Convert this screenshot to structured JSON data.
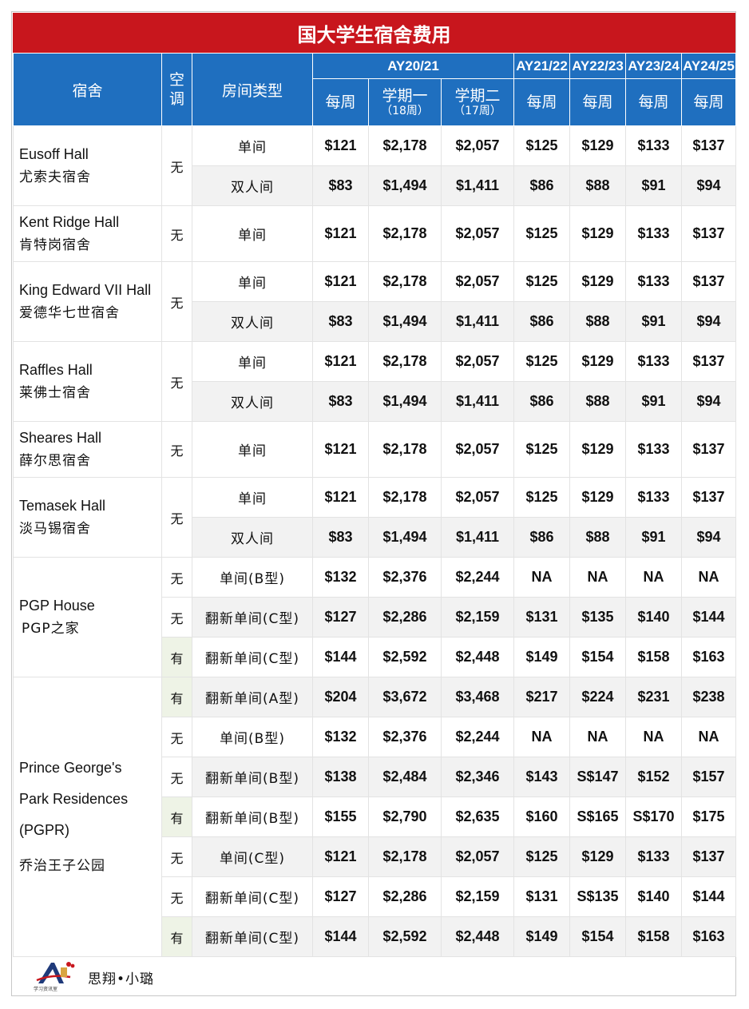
{
  "title": "国大学生宿舍费用",
  "headers": {
    "hall": "宿舍",
    "ac": "空调",
    "room_type": "房间类型",
    "ay2021": "AY20/21",
    "ay2122": "AY21/22",
    "ay2223": "AY22/23",
    "ay2324": "AY23/24",
    "ay2425": "AY24/25",
    "weekly": "每周",
    "sem1": "学期一",
    "sem1_weeks": "（18周）",
    "sem2": "学期二",
    "sem2_weeks": "（17周）"
  },
  "rows": [
    {
      "hall_en": "Eusoff Hall",
      "hall_cn": "尤索夫宿舍",
      "ac": "无",
      "room": "单间",
      "vals": [
        "$121",
        "$2,178",
        "$2,057",
        "$125",
        "$129",
        "$133",
        "$137"
      ]
    },
    {
      "ac": "",
      "room": "双人间",
      "vals": [
        "$83",
        "$1,494",
        "$1,411",
        "$86",
        "$88",
        "$91",
        "$94"
      ]
    },
    {
      "hall_en": "Kent Ridge Hall",
      "hall_cn": "肯特岗宿舍",
      "ac": "无",
      "room": "单间",
      "vals": [
        "$121",
        "$2,178",
        "$2,057",
        "$125",
        "$129",
        "$133",
        "$137"
      ]
    },
    {
      "hall_en": "King Edward VII Hall",
      "hall_cn": "爱德华七世宿舍",
      "ac": "无",
      "room": "单间",
      "vals": [
        "$121",
        "$2,178",
        "$2,057",
        "$125",
        "$129",
        "$133",
        "$137"
      ]
    },
    {
      "ac": "",
      "room": "双人间",
      "vals": [
        "$83",
        "$1,494",
        "$1,411",
        "$86",
        "$88",
        "$91",
        "$94"
      ]
    },
    {
      "hall_en": "Raffles Hall",
      "hall_cn": "莱佛士宿舍",
      "ac": "无",
      "room": "单间",
      "vals": [
        "$121",
        "$2,178",
        "$2,057",
        "$125",
        "$129",
        "$133",
        "$137"
      ]
    },
    {
      "ac": "",
      "room": "双人间",
      "vals": [
        "$83",
        "$1,494",
        "$1,411",
        "$86",
        "$88",
        "$91",
        "$94"
      ]
    },
    {
      "hall_en": "Sheares Hall",
      "hall_cn": "薛尔思宿舍",
      "ac": "无",
      "room": "单间",
      "vals": [
        "$121",
        "$2,178",
        "$2,057",
        "$125",
        "$129",
        "$133",
        "$137"
      ]
    },
    {
      "hall_en": "Temasek Hall",
      "hall_cn": "淡马锡宿舍",
      "ac": "无",
      "room": "单间",
      "vals": [
        "$121",
        "$2,178",
        "$2,057",
        "$125",
        "$129",
        "$133",
        "$137"
      ]
    },
    {
      "ac": "",
      "room": "双人间",
      "vals": [
        "$83",
        "$1,494",
        "$1,411",
        "$86",
        "$88",
        "$91",
        "$94"
      ]
    },
    {
      "hall_en": "PGP House",
      "hall_cn": "PGP之家",
      "ac": "无",
      "room": "单间(B型)",
      "vals": [
        "$132",
        "$2,376",
        "$2,244",
        "NA",
        "NA",
        "NA",
        "NA"
      ]
    },
    {
      "ac": "无",
      "room": "翻新单间(C型)",
      "vals": [
        "$127",
        "$2,286",
        "$2,159",
        "$131",
        "$135",
        "$140",
        "$144"
      ]
    },
    {
      "ac": "有",
      "room": "翻新单间(C型)",
      "vals": [
        "$144",
        "$2,592",
        "$2,448",
        "$149",
        "$154",
        "$158",
        "$163"
      ]
    },
    {
      "hall_en": "Prince George's",
      "hall_en2": "Park  Residences",
      "hall_en3": "(PGPR)",
      "hall_cn": "乔治王子公园",
      "ac": "有",
      "room": "翻新单间(A型)",
      "vals": [
        "$204",
        "$3,672",
        "$3,468",
        "$217",
        "$224",
        "$231",
        "$238"
      ]
    },
    {
      "ac": "无",
      "room": "单间(B型)",
      "vals": [
        "$132",
        "$2,376",
        "$2,244",
        "NA",
        "NA",
        "NA",
        "NA"
      ]
    },
    {
      "ac": "无",
      "room": "翻新单间(B型)",
      "vals": [
        "$138",
        "$2,484",
        "$2,346",
        "$143",
        "S$147",
        "$152",
        "$157"
      ]
    },
    {
      "ac": "有",
      "room": "翻新单间(B型)",
      "vals": [
        "$155",
        "$2,790",
        "$2,635",
        "$160",
        "S$165",
        "S$170",
        "$175"
      ]
    },
    {
      "ac": "无",
      "room": "单间(C型)",
      "vals": [
        "$121",
        "$2,178",
        "$2,057",
        "$125",
        "$129",
        "$133",
        "$137"
      ]
    },
    {
      "ac": "无",
      "room": "翻新单间(C型)",
      "vals": [
        "$127",
        "$2,286",
        "$2,159",
        "$131",
        "S$135",
        "$140",
        "$144"
      ]
    },
    {
      "ac": "有",
      "room": "翻新单间(C型)",
      "vals": [
        "$144",
        "$2,592",
        "$2,448",
        "$149",
        "$154",
        "$158",
        "$163"
      ]
    }
  ],
  "footer": {
    "logo_text": "学习资讯室",
    "author": "思翔•小璐"
  },
  "colors": {
    "title_bg": "#c8161d",
    "header_bg": "#1f6fbf",
    "alt_row": "#f2f2f2",
    "ac_yes": "#eef3e6"
  }
}
